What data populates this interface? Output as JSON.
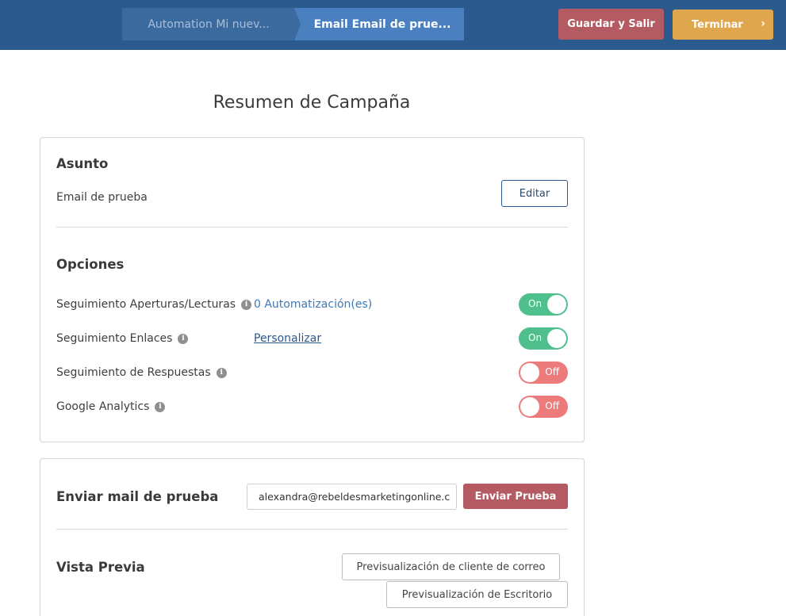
{
  "header": {
    "breadcrumbs": [
      {
        "label": "Automation Mi nuev..."
      },
      {
        "label": "Email Email de prue..."
      }
    ],
    "save_label": "Guardar y Salir",
    "finish_label": "Terminar",
    "colors": {
      "bar": "#2b5a8e",
      "save": "#b35a62",
      "finish": "#e0a64e"
    }
  },
  "page": {
    "title": "Resumen de Campaña"
  },
  "subject": {
    "heading": "Asunto",
    "value": "Email de prueba",
    "edit_label": "Editar"
  },
  "options": {
    "heading": "Opciones",
    "items": [
      {
        "label": "Seguimiento Aperturas/Lecturas",
        "link": "0 Automatización(es)",
        "state": "On"
      },
      {
        "label": "Seguimiento Enlaces",
        "link": "Personalizar",
        "state": "On"
      },
      {
        "label": "Seguimiento de Respuestas",
        "state": "Off"
      },
      {
        "label": "Google Analytics",
        "state": "Off"
      }
    ],
    "colors": {
      "on": "#4fbf8d",
      "off": "#ee7b7c"
    }
  },
  "test_email": {
    "heading": "Enviar mail de prueba",
    "input_value": "alexandra@rebeldesmarketingonline.com",
    "send_label": "Enviar Prueba"
  },
  "preview": {
    "heading": "Vista Previa",
    "client_label": "Previsualización de cliente de correo",
    "desktop_label": "Previsualización de Escritorio"
  }
}
